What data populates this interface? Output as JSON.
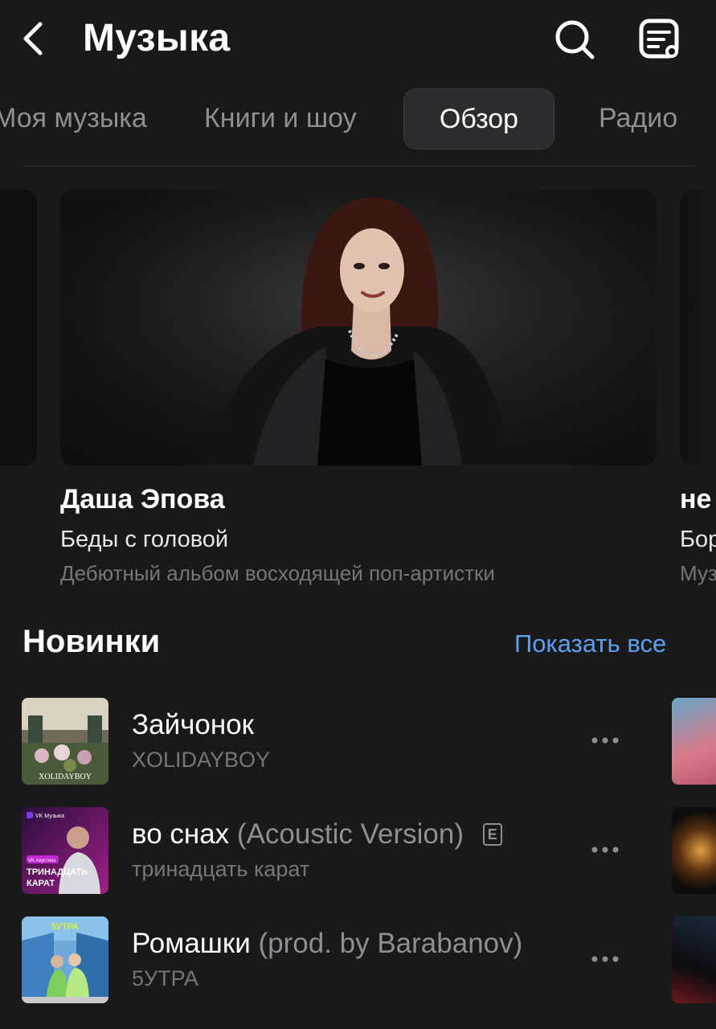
{
  "header": {
    "title": "Музыка",
    "icons": {
      "back": "chevron-left-icon",
      "search": "search-icon",
      "playlist": "playlist-icon"
    }
  },
  "tabs": [
    {
      "label": "Моя музыка",
      "active": false
    },
    {
      "label": "Книги и шоу",
      "active": false
    },
    {
      "label": "Обзор",
      "active": true
    },
    {
      "label": "Радио",
      "active": false
    }
  ],
  "featured": {
    "main": {
      "artist": "Даша Эпова",
      "album": "Беды с головой",
      "description": "Дебютный альбом восходящей поп-артистки"
    },
    "next": {
      "artist": "не",
      "album": "Бор",
      "description": "Муз"
    }
  },
  "new_releases": {
    "title": "Новинки",
    "show_all": "Показать все",
    "tracks": [
      {
        "title": "Зайчонок",
        "suffix": "",
        "explicit": false,
        "artist": "XOLIDAYBOY",
        "cover_caption": "XOLIDAYBOY"
      },
      {
        "title": "во снах",
        "suffix": "(Acoustic Version)",
        "explicit": true,
        "explicit_label": "E",
        "artist": "тринадцать карат",
        "cover_caption": "ТРИНАДЦАТЬ КАРАТ",
        "cover_brand": "VK Музыка",
        "cover_tag": "VK Акустика"
      },
      {
        "title": "Ромашки",
        "suffix": "(prod. by Barabanov)",
        "explicit": false,
        "artist": "5УТРА",
        "cover_caption": "5УТРА"
      }
    ]
  },
  "colors": {
    "background": "#19191a",
    "accent": "#5aa0ef",
    "secondary_text": "#8e8e93",
    "tab_active_bg": "#2c2c2e"
  }
}
